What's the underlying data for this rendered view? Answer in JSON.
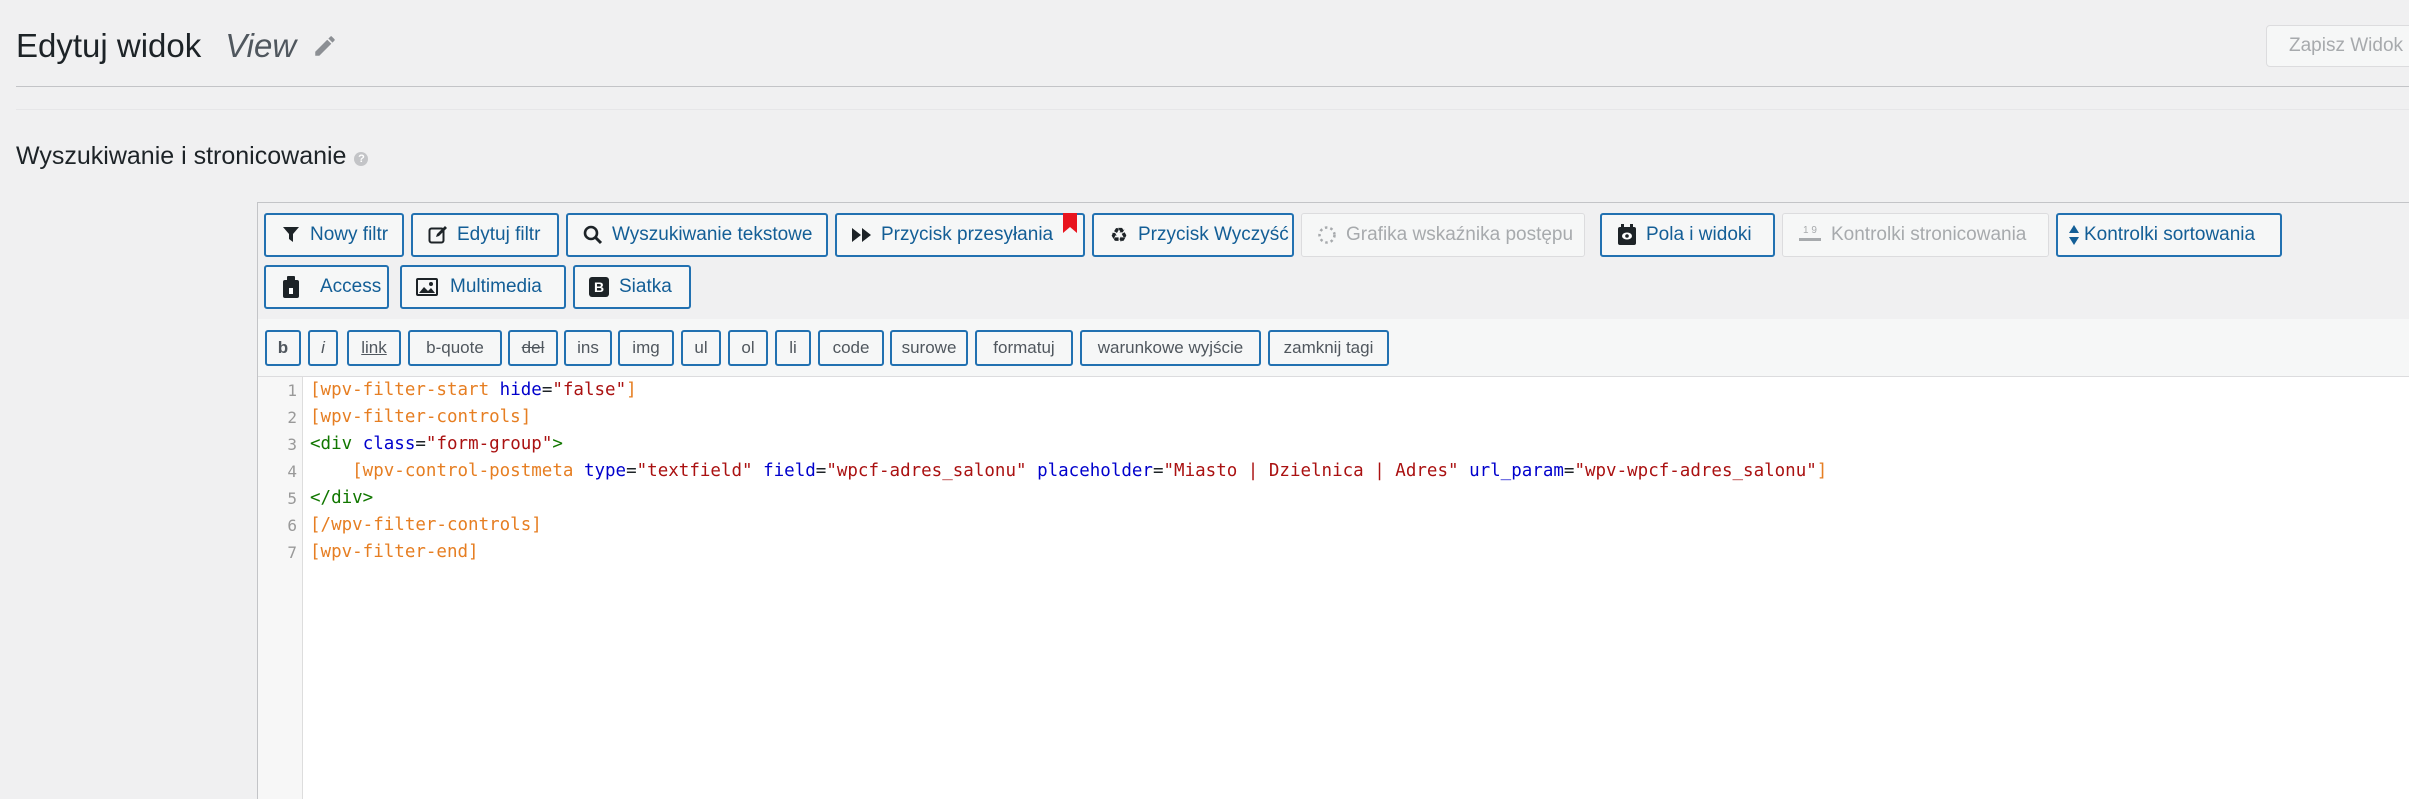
{
  "header": {
    "title": "Edytuj widok",
    "view_name": "View",
    "save_label": "Zapisz Widok"
  },
  "section": {
    "title": "Wyszukiwanie i stronicowanie",
    "help_glyph": "?"
  },
  "toolbar": {
    "buttons": [
      {
        "label": "Nowy filtr",
        "icon": "filter-icon"
      },
      {
        "label": "Edytuj filtr",
        "icon": "edit-icon"
      },
      {
        "label": "Wyszukiwanie tekstowe",
        "icon": "search-icon"
      },
      {
        "label": "Przycisk przesyłania",
        "icon": "fast-forward-icon"
      },
      {
        "label": "Przycisk Wyczyść",
        "icon": "recycle-icon"
      },
      {
        "label": "Grafika wskaźnika postępu",
        "icon": "spinner-icon"
      },
      {
        "label": "Pola i widoki",
        "icon": "toolset-icon"
      },
      {
        "label": "Kontrolki stronicowania",
        "icon": "pagination-icon",
        "icon_text": "1 9"
      },
      {
        "label": "Kontrolki sortowania",
        "icon": "sort-icon"
      },
      {
        "label": "Access",
        "icon": "lock-clipboard-icon"
      },
      {
        "label": "Multimedia",
        "icon": "image-icon"
      },
      {
        "label": "Siatka",
        "icon": "bootstrap-icon",
        "icon_text": "B"
      }
    ]
  },
  "quicktags": [
    "b",
    "i",
    "link",
    "b-quote",
    "del",
    "ins",
    "img",
    "ul",
    "ol",
    "li",
    "code",
    "surowe",
    "formatuj",
    "warunkowe wyjście",
    "zamknij tagi"
  ],
  "editor": {
    "line_numbers": [
      "1",
      "2",
      "3",
      "4",
      "5",
      "6",
      "7"
    ],
    "lines": [
      [
        {
          "t": "[wpv-filter-start ",
          "c": "sc"
        },
        {
          "t": "hide",
          "c": "attr"
        },
        {
          "t": "=",
          "c": "pl"
        },
        {
          "t": "\"false\"",
          "c": "str"
        },
        {
          "t": "]",
          "c": "sc"
        }
      ],
      [
        {
          "t": "[wpv-filter-controls]",
          "c": "sc"
        }
      ],
      [
        {
          "t": "<div ",
          "c": "tag"
        },
        {
          "t": "class",
          "c": "attr"
        },
        {
          "t": "=",
          "c": "pl"
        },
        {
          "t": "\"form-group\"",
          "c": "str"
        },
        {
          "t": ">",
          "c": "tag"
        }
      ],
      [
        {
          "t": "    [wpv-control-postmeta ",
          "c": "sc"
        },
        {
          "t": "type",
          "c": "attr"
        },
        {
          "t": "=",
          "c": "pl"
        },
        {
          "t": "\"textfield\"",
          "c": "str"
        },
        {
          "t": " ",
          "c": "pl"
        },
        {
          "t": "field",
          "c": "attr"
        },
        {
          "t": "=",
          "c": "pl"
        },
        {
          "t": "\"wpcf-adres_salonu\"",
          "c": "str"
        },
        {
          "t": " ",
          "c": "pl"
        },
        {
          "t": "placeholder",
          "c": "attr"
        },
        {
          "t": "=",
          "c": "pl"
        },
        {
          "t": "\"Miasto | Dzielnica | Adres\"",
          "c": "str"
        },
        {
          "t": " ",
          "c": "pl"
        },
        {
          "t": "url_param",
          "c": "attr"
        },
        {
          "t": "=",
          "c": "pl"
        },
        {
          "t": "\"wpv-wpcf-adres_salonu\"",
          "c": "str"
        },
        {
          "t": "]",
          "c": "sc"
        }
      ],
      [
        {
          "t": "</div>",
          "c": "tag"
        }
      ],
      [
        {
          "t": "[/wpv-filter-controls]",
          "c": "sc"
        }
      ],
      [
        {
          "t": "[wpv-filter-end]",
          "c": "sc"
        }
      ]
    ]
  },
  "colors": {
    "accent": "#2271b1",
    "button_text": "#135e96",
    "shortcode": "#e67e22",
    "html_tag": "#117700",
    "attribute": "#0000cc",
    "string": "#aa1111",
    "bookmark": "#e8141e"
  }
}
